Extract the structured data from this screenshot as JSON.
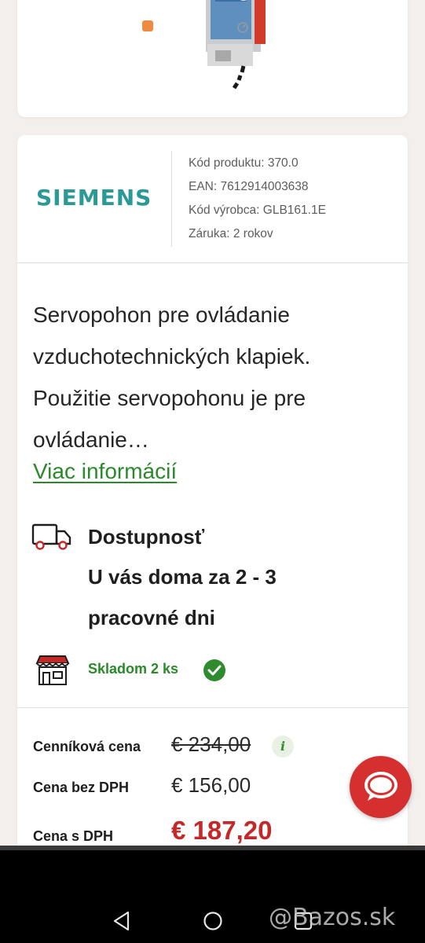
{
  "product": {
    "brand_logo": "SIEMENS",
    "specs": [
      "Kód produktu: 370.0",
      "EAN: 7612914003638",
      "Kód výrobca: GLB161.1E",
      "Záruka: 2 rokov"
    ],
    "description": "Servopohon pre ovládanie vzduchotechnických klapiek. Použitie servopohonu je pre ovládanie…",
    "more_link": "Viac informácií"
  },
  "availability": {
    "title": "Dostupnosť",
    "text": "U vás doma za 2 - 3 pracovné dni",
    "stock": "Skladom 2 ks"
  },
  "prices": {
    "list_label": "Cenníková cena",
    "list_value": "€ 234,00",
    "info_icon": "i",
    "net_label": "Cena bez DPH",
    "net_value": "€ 156,00",
    "gross_label": "Cena s DPH",
    "gross_value": "€ 187,20"
  },
  "watermark": "@Bazos.sk",
  "colors": {
    "brand_teal": "#2a9a96",
    "link_green": "#2a8a2a",
    "price_red": "#c42828",
    "chat_red": "#d62f2f"
  },
  "icons": [
    "shield-icon",
    "gauge-icon",
    "truck-icon",
    "store-icon",
    "check-icon",
    "info-icon",
    "chat-icon",
    "back-icon",
    "home-icon",
    "recents-icon"
  ]
}
